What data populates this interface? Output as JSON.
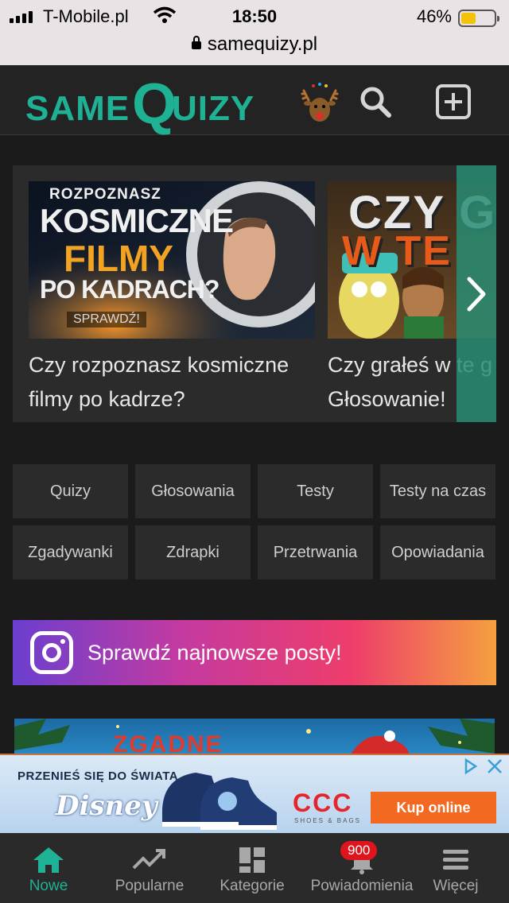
{
  "status_bar": {
    "carrier": "T-Mobile.pl",
    "time": "18:50",
    "battery_percent": "46%",
    "battery_level": 0.46,
    "battery_color": "#f3c20a"
  },
  "browser": {
    "url": "samequizy.pl"
  },
  "header": {
    "logo": {
      "same": "SAME",
      "q": "Q",
      "uizy": "UIZY"
    },
    "brand_color": "#1fb194",
    "icons": [
      "reindeer-icon",
      "search-icon",
      "add-icon"
    ]
  },
  "carousel": {
    "cards": [
      {
        "title": "Czy rozpoznasz kosmiczne filmy po kadrze?",
        "title_line1": "Czy rozpoznasz kosmiczne",
        "title_line2": "filmy po kadrze?",
        "thumb_text": [
          "ROZPOZNASZ",
          "KOSMICZNE",
          "FILMY",
          "PO KADRACH?",
          "SPRAWDŹ!"
        ]
      },
      {
        "title_line1": "Czy grałeś w te g",
        "title_line2": "Głosowanie!",
        "thumb_text": [
          "CZY GR",
          "W TE"
        ]
      }
    ],
    "next_icon": "chevron-right-icon"
  },
  "categories": [
    "Quizy",
    "Głosowania",
    "Testy",
    "Testy na czas",
    "Zgadywanki",
    "Zdrapki",
    "Przetrwania",
    "Opowiadania"
  ],
  "instagram_banner": {
    "text": "Sprawdź najnowsze posty!"
  },
  "xmas_banner": {
    "text": "ZGADNE"
  },
  "ad": {
    "line1": "PRZENIEŚ SIĘ DO ŚWIATA",
    "brand": "Disney",
    "store": "CCC",
    "store_sub": "SHOES & BAGS",
    "cta": "Kup online"
  },
  "tabbar": {
    "tabs": [
      {
        "label": "Nowe",
        "icon": "home-icon",
        "active": true
      },
      {
        "label": "Popularne",
        "icon": "trending-icon"
      },
      {
        "label": "Kategorie",
        "icon": "grid-icon"
      },
      {
        "label": "Powiadomienia",
        "icon": "bell-icon",
        "badge": "900"
      },
      {
        "label": "Więcej",
        "icon": "menu-icon"
      }
    ]
  }
}
